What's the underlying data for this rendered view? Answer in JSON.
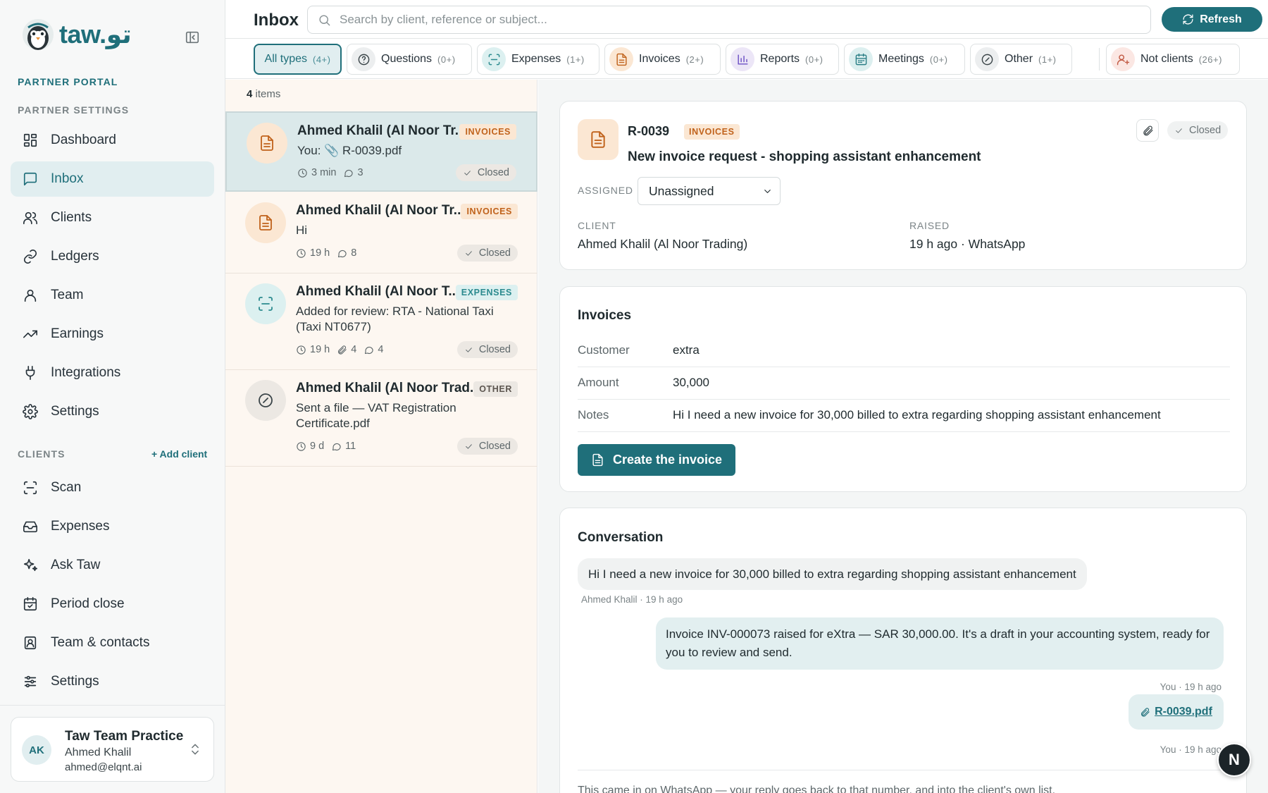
{
  "brand": {
    "name": "taw.تو"
  },
  "sidebar": {
    "portal_label": "PARTNER PORTAL",
    "settings_label": "PARTNER SETTINGS",
    "partner_items": [
      {
        "label": "Dashboard",
        "icon": "dashboard-icon"
      },
      {
        "label": "Inbox",
        "icon": "inbox-icon",
        "active": true
      },
      {
        "label": "Clients",
        "icon": "users-icon"
      },
      {
        "label": "Ledgers",
        "icon": "link-icon"
      },
      {
        "label": "Team",
        "icon": "user-icon"
      },
      {
        "label": "Earnings",
        "icon": "trending-up-icon"
      },
      {
        "label": "Integrations",
        "icon": "plug-icon"
      },
      {
        "label": "Settings",
        "icon": "gear-icon"
      }
    ],
    "clients_label": "CLIENTS",
    "add_client": "+ Add client",
    "client_items": [
      {
        "label": "Scan",
        "icon": "scan-icon"
      },
      {
        "label": "Expenses",
        "icon": "tray-icon"
      },
      {
        "label": "Ask Taw",
        "icon": "sparkle-icon"
      },
      {
        "label": "Period close",
        "icon": "calendar-check-icon"
      },
      {
        "label": "Team & contacts",
        "icon": "contact-icon"
      },
      {
        "label": "Settings",
        "icon": "sliders-icon"
      }
    ],
    "user": {
      "initials": "AK",
      "practice": "Taw Team Practice",
      "name": "Ahmed Khalil",
      "email": "ahmed@elqnt.ai"
    }
  },
  "header": {
    "title": "Inbox",
    "search_placeholder": "Search by client, reference or subject...",
    "refresh_label": "Refresh"
  },
  "filters": [
    {
      "label": "All types",
      "count": "(4+)",
      "active": true
    },
    {
      "label": "Questions",
      "count": "(0+)",
      "icon": "question-icon",
      "icon_bg": "#eceeef",
      "icon_color": "#3a4448"
    },
    {
      "label": "Expenses",
      "count": "(1+)",
      "icon": "scan-icon",
      "icon_bg": "#dcf0f0",
      "icon_color": "#2b8a8e"
    },
    {
      "label": "Invoices",
      "count": "(2+)",
      "icon": "document-icon",
      "icon_bg": "#fbe7d3",
      "icon_color": "#c0621b"
    },
    {
      "label": "Reports",
      "count": "(0+)",
      "icon": "bar-chart-icon",
      "icon_bg": "#ece6f7",
      "icon_color": "#6b4fc4"
    },
    {
      "label": "Meetings",
      "count": "(0+)",
      "icon": "calendar-icon",
      "icon_bg": "#dcefef",
      "icon_color": "#2b7f86"
    },
    {
      "label": "Other",
      "count": "(1+)",
      "icon": "circle-slash-icon",
      "icon_bg": "#eceeef",
      "icon_color": "#3a4448"
    },
    {
      "label": "Not clients",
      "count": "(26+)",
      "icon": "user-plus-icon",
      "icon_bg": "#fbe7e3",
      "icon_color": "#c25a44"
    }
  ],
  "list": {
    "count": "4",
    "count_suffix": " items",
    "rows": [
      {
        "title": "Ahmed Khalil (Al Noor Tr...",
        "tag": "INVOICES",
        "subtitle": "You: 📎 R-0039.pdf",
        "time": "3 min",
        "attachments": "",
        "comments": "3",
        "status": "Closed",
        "icon": "document-icon"
      },
      {
        "title": "Ahmed Khalil (Al Noor Tr...",
        "tag": "INVOICES",
        "subtitle": "Hi",
        "time": "19 h",
        "attachments": "",
        "comments": "8",
        "status": "Closed",
        "icon": "document-icon"
      },
      {
        "title": "Ahmed Khalil (Al Noor T...",
        "tag": "EXPENSES",
        "subtitle": "Added for review: RTA - National Taxi (Taxi NT0677)",
        "time": "19 h",
        "attachments": "4",
        "comments": "4",
        "status": "Closed",
        "icon": "scan-icon"
      },
      {
        "title": "Ahmed Khalil (Al Noor Trad...",
        "tag": "OTHER",
        "subtitle": "Sent a file — VAT Registration Certificate.pdf",
        "time": "9 d",
        "attachments": "",
        "comments": "11",
        "status": "Closed",
        "icon": "circle-slash-icon"
      }
    ]
  },
  "detail": {
    "ref": "R-0039",
    "tag": "INVOICES",
    "subject": "New invoice request - shopping assistant enhancement",
    "status": "Closed",
    "assigned_label": "ASSIGNED",
    "assigned_value": "Unassigned",
    "client_label": "CLIENT",
    "client_value": "Ahmed Khalil (Al Noor Trading)",
    "raised_label": "RAISED",
    "raised_value": "19 h ago · WhatsApp",
    "invoices": {
      "title": "Invoices",
      "fields": [
        {
          "k": "Customer",
          "v": "extra"
        },
        {
          "k": "Amount",
          "v": "30,000"
        },
        {
          "k": "Notes",
          "v": "Hi I need a new invoice for 30,000 billed to extra regarding shopping assistant enhancement"
        }
      ],
      "create_label": "Create the invoice"
    },
    "conversation": {
      "title": "Conversation",
      "incoming": "Hi I need a new invoice for 30,000 billed to extra regarding shopping assistant enhancement",
      "incoming_meta": "Ahmed Khalil · 19 h ago",
      "outgoing": "Invoice INV-000073 raised for eXtra — SAR 30,000.00. It's a draft in your accounting system, ready for you to review and send.",
      "outgoing_meta": "You · 19 h ago",
      "file": "R-0039.pdf",
      "file_meta": "You · 19 h ago",
      "footnote": "This came in on WhatsApp — your reply goes back to that number, and into the client's own list."
    }
  },
  "fab_label": "N",
  "colors": {
    "accent": "#1f6f7a",
    "invoice": "#c0621b",
    "expense": "#2b8a8e"
  }
}
